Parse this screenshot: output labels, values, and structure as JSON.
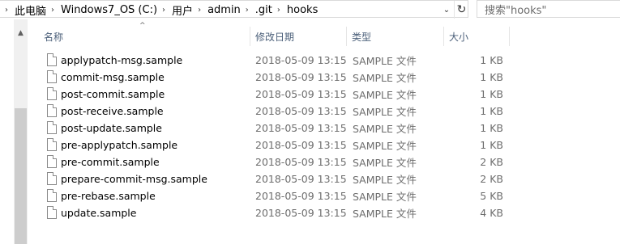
{
  "address": {
    "breadcrumbs": [
      "此电脑",
      "Windows7_OS (C:)",
      "用户",
      "admin",
      ".git",
      "hooks"
    ],
    "separator_icon": "chevron-right-icon"
  },
  "search": {
    "placeholder": "搜索\"hooks\""
  },
  "columns": {
    "name": "名称",
    "date": "修改日期",
    "type": "类型",
    "size": "大小"
  },
  "files": [
    {
      "name": "applypatch-msg.sample",
      "date": "2018-05-09 13:15",
      "type": "SAMPLE 文件",
      "size": "1 KB"
    },
    {
      "name": "commit-msg.sample",
      "date": "2018-05-09 13:15",
      "type": "SAMPLE 文件",
      "size": "1 KB"
    },
    {
      "name": "post-commit.sample",
      "date": "2018-05-09 13:15",
      "type": "SAMPLE 文件",
      "size": "1 KB"
    },
    {
      "name": "post-receive.sample",
      "date": "2018-05-09 13:15",
      "type": "SAMPLE 文件",
      "size": "1 KB"
    },
    {
      "name": "post-update.sample",
      "date": "2018-05-09 13:15",
      "type": "SAMPLE 文件",
      "size": "1 KB"
    },
    {
      "name": "pre-applypatch.sample",
      "date": "2018-05-09 13:15",
      "type": "SAMPLE 文件",
      "size": "1 KB"
    },
    {
      "name": "pre-commit.sample",
      "date": "2018-05-09 13:15",
      "type": "SAMPLE 文件",
      "size": "2 KB"
    },
    {
      "name": "prepare-commit-msg.sample",
      "date": "2018-05-09 13:15",
      "type": "SAMPLE 文件",
      "size": "2 KB"
    },
    {
      "name": "pre-rebase.sample",
      "date": "2018-05-09 13:15",
      "type": "SAMPLE 文件",
      "size": "5 KB"
    },
    {
      "name": "update.sample",
      "date": "2018-05-09 13:15",
      "type": "SAMPLE 文件",
      "size": "4 KB"
    }
  ]
}
